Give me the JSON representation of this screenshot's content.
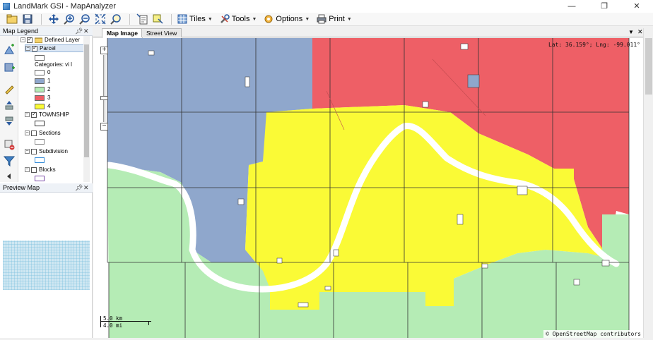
{
  "window": {
    "title": "LandMark GSI - MapAnalyzer"
  },
  "toolbar": {
    "tiles_label": "Tiles",
    "tools_label": "Tools",
    "options_label": "Options",
    "print_label": "Print"
  },
  "legend_panel": {
    "title": "Map Legend",
    "items": [
      {
        "label": "Defined Layer",
        "checked": true
      },
      {
        "label": "Parcel",
        "checked": true
      },
      {
        "label": "Categories: vi l"
      },
      {
        "label": "0",
        "color": "#ffffff"
      },
      {
        "label": "1",
        "color": "#8fa7cc"
      },
      {
        "label": "2",
        "color": "#b5ecb5"
      },
      {
        "label": "3",
        "color": "#ee5f66"
      },
      {
        "label": "4",
        "color": "#fafa36"
      },
      {
        "label": "TOWNSHIP",
        "checked": true
      },
      {
        "label": "Sections",
        "checked": false
      },
      {
        "label": "Subdivision",
        "checked": false
      },
      {
        "label": "Blocks",
        "checked": false
      }
    ]
  },
  "preview_panel": {
    "title": "Preview Map"
  },
  "tabs": {
    "map_image": "Map Image",
    "street_view": "Street View"
  },
  "map": {
    "coordinates": "Lat: 36.159°; Lng: -99.011°",
    "attribution": "© OpenStreetMap contributors",
    "scale_km": "5.0 km",
    "scale_mi": "4.0 mi",
    "zone_colors": {
      "blue": "#8fa7cc",
      "green": "#b5ecb5",
      "red": "#ee5f66",
      "yellow": "#fafa36"
    }
  }
}
